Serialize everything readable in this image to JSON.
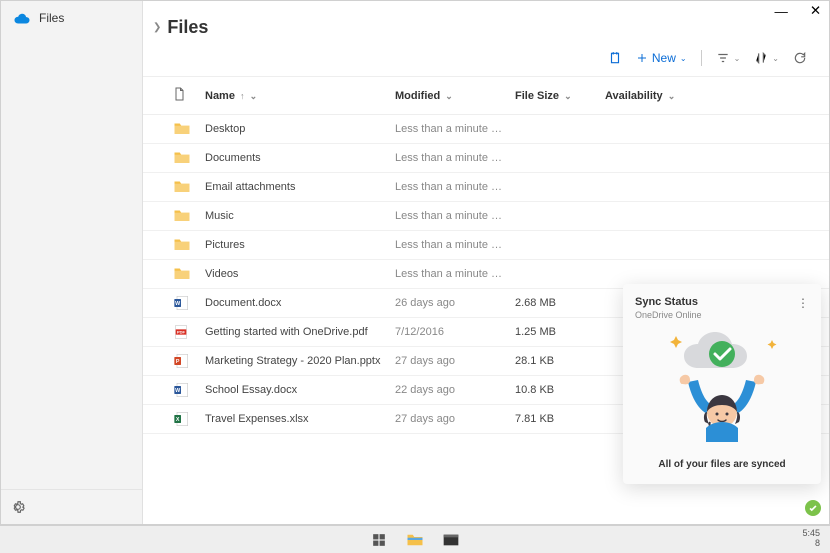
{
  "sidebar": {
    "app_label": "Files",
    "settings_tooltip": "Settings"
  },
  "header": {
    "breadcrumb": "Files"
  },
  "toolbar": {
    "new_label": "New"
  },
  "columns": {
    "name": "Name",
    "modified": "Modified",
    "filesize": "File Size",
    "availability": "Availability"
  },
  "files": [
    {
      "icon": "folder",
      "name": "Desktop",
      "modified": "Less than a minute ago",
      "size": "",
      "availability": ""
    },
    {
      "icon": "folder",
      "name": "Documents",
      "modified": "Less than a minute ago",
      "size": "",
      "availability": ""
    },
    {
      "icon": "folder",
      "name": "Email attachments",
      "modified": "Less than a minute ago",
      "size": "",
      "availability": ""
    },
    {
      "icon": "folder",
      "name": "Music",
      "modified": "Less than a minute ago",
      "size": "",
      "availability": ""
    },
    {
      "icon": "folder",
      "name": "Pictures",
      "modified": "Less than a minute ago",
      "size": "",
      "availability": ""
    },
    {
      "icon": "folder",
      "name": "Videos",
      "modified": "Less than a minute ago",
      "size": "",
      "availability": ""
    },
    {
      "icon": "word",
      "name": "Document.docx",
      "modified": "26 days ago",
      "size": "2.68 MB",
      "availability": ""
    },
    {
      "icon": "pdf",
      "name": "Getting started with OneDrive.pdf",
      "modified": "7/12/2016",
      "size": "1.25 MB",
      "availability": ""
    },
    {
      "icon": "ppt",
      "name": "Marketing Strategy - 2020 Plan.pptx",
      "modified": "27 days ago",
      "size": "28.1 KB",
      "availability": ""
    },
    {
      "icon": "word",
      "name": "School Essay.docx",
      "modified": "22 days ago",
      "size": "10.8 KB",
      "availability": ""
    },
    {
      "icon": "xls",
      "name": "Travel Expenses.xlsx",
      "modified": "27 days ago",
      "size": "7.81 KB",
      "availability": ""
    }
  ],
  "popup": {
    "title": "Sync Status",
    "subtitle": "OneDrive Online",
    "message": "All of your files are synced"
  },
  "taskbar": {
    "time": "5:45",
    "date": "8"
  }
}
